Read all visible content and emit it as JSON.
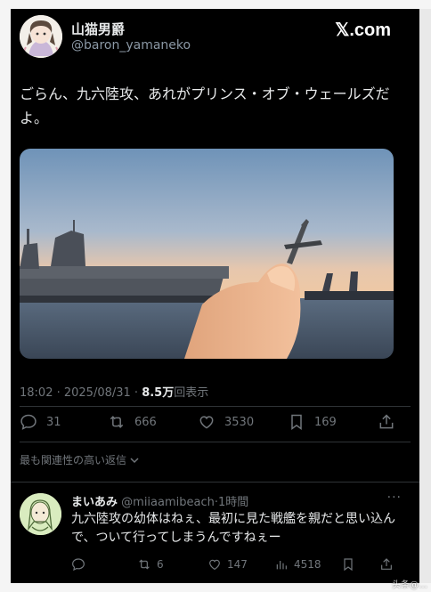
{
  "header": {
    "display_name": "山猫男爵",
    "handle": "@baron_yamaneko",
    "site_logo": "𝕏.com",
    "avatar_icon": "anime-girl-avatar"
  },
  "tweet": {
    "text": "ごらん、九六陸攻、あれがプリンス・オブ・ウェールズだよ。",
    "photo": "aircraft-carrier-with-model-plane-photo",
    "meta_time": "18:02 · 2025/08/31 · ",
    "meta_views_count": "8.5万",
    "meta_views_label": "回表示"
  },
  "actions": {
    "replies": "31",
    "reposts": "666",
    "likes": "3530",
    "bookmarks": "169"
  },
  "sort_label": "最も関連性の高い返信",
  "reply": {
    "name": "まいあみ",
    "handle": "@miiaamibeach",
    "time": "·1時間",
    "more": "···",
    "text": "九六陸攻の幼体はねぇ、最初に見た戦艦を親だと思い込んで、ついて行ってしまうんですねぇー",
    "replies": "",
    "reposts": "6",
    "likes": "147",
    "views": "4518"
  },
  "watermark": "头条@…"
}
